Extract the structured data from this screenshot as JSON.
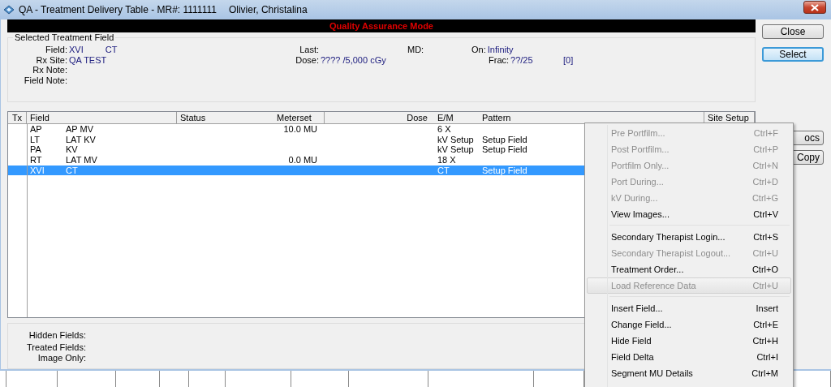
{
  "window": {
    "title": "QA - Treatment Delivery Table - MR#: 1111111",
    "patient": "Olivier, Christalina"
  },
  "banner": "Quality Assurance Mode",
  "selected_field": {
    "title": "Selected Treatment Field",
    "rows": [
      [
        {
          "label": "Field:",
          "values": [
            "XVI",
            "CT"
          ]
        },
        {
          "label": "Last:"
        },
        {
          "label": "MD:"
        },
        {
          "label": "On:",
          "values": [
            "Infinity"
          ]
        }
      ],
      [
        {
          "label": "Rx Site:",
          "values": [
            "QA TEST"
          ]
        },
        {
          "label": "Dose:",
          "values": [
            "???? /5,000 cGy"
          ]
        },
        "",
        {
          "label": "Frac:",
          "values": [
            "??/25"
          ]
        },
        {
          "values": [
            "[0]"
          ]
        }
      ],
      [
        {
          "label": "Rx Note:"
        }
      ],
      [
        {
          "label": "Field Note:"
        }
      ]
    ]
  },
  "table": {
    "columns": [
      "Tx",
      "Field",
      "Status",
      "Meterset",
      "Dose",
      "E/M",
      "Pattern",
      "Site Setup"
    ],
    "rows": [
      {
        "code": "AP",
        "name": "AP MV",
        "meterset": "10.0 MU",
        "em": "6 X",
        "selected": false
      },
      {
        "code": "LT",
        "name": "LAT KV",
        "em": "kV Setup",
        "pattern": "Setup Field",
        "selected": false
      },
      {
        "code": "PA",
        "name": "KV",
        "em": "kV Setup",
        "pattern": "Setup Field",
        "selected": false
      },
      {
        "code": "RT",
        "name": "LAT MV",
        "meterset": "0.0 MU",
        "em": "18 X",
        "selected": false
      },
      {
        "code": "XVI",
        "name": "CT",
        "em": "CT",
        "pattern": "Setup Field",
        "selected": true
      }
    ]
  },
  "summary": [
    "Hidden Fields:",
    "Treated Fields:",
    "Image Only:"
  ],
  "buttons": [
    {
      "label": "Close",
      "kind": "normal"
    },
    {
      "label": "Select",
      "kind": "focused"
    },
    {
      "label": "ocs",
      "kind": "covered"
    },
    {
      "label": "Copy",
      "kind": "covered"
    }
  ],
  "context_menu": [
    {
      "kind": "item",
      "label": "Pre Portfilm...",
      "shortcut": "Ctrl+F",
      "disabled": true,
      "highlighted": false
    },
    {
      "kind": "item",
      "label": "Post Portfilm...",
      "shortcut": "Ctrl+P",
      "disabled": true,
      "highlighted": false
    },
    {
      "kind": "item",
      "label": "Portfilm Only...",
      "shortcut": "Ctrl+N",
      "disabled": true,
      "highlighted": false
    },
    {
      "kind": "item",
      "label": "Port During...",
      "shortcut": "Ctrl+D",
      "disabled": true,
      "highlighted": false
    },
    {
      "kind": "item",
      "label": "kV During...",
      "shortcut": "Ctrl+G",
      "disabled": true,
      "highlighted": false
    },
    {
      "kind": "item",
      "label": "View Images...",
      "shortcut": "Ctrl+V",
      "disabled": false,
      "highlighted": false
    },
    {
      "kind": "separator"
    },
    {
      "kind": "item",
      "label": "Secondary Therapist Login...",
      "shortcut": "Ctrl+S",
      "disabled": false,
      "highlighted": false
    },
    {
      "kind": "item",
      "label": "Secondary Therapist Logout...",
      "shortcut": "Ctrl+U",
      "disabled": true,
      "highlighted": false
    },
    {
      "kind": "item",
      "label": "Treatment Order...",
      "shortcut": "Ctrl+O",
      "disabled": false,
      "highlighted": false
    },
    {
      "kind": "item",
      "label": "Load Reference Data",
      "shortcut": "Ctrl+U",
      "disabled": true,
      "highlighted": true
    },
    {
      "kind": "separator"
    },
    {
      "kind": "item",
      "label": "Insert Field...",
      "shortcut": "Insert",
      "disabled": false,
      "highlighted": false
    },
    {
      "kind": "item",
      "label": "Change Field...",
      "shortcut": "Ctrl+E",
      "disabled": false,
      "highlighted": false
    },
    {
      "kind": "item",
      "label": "Hide Field",
      "shortcut": "Ctrl+H",
      "disabled": false,
      "highlighted": false
    },
    {
      "kind": "item",
      "label": "Field Delta",
      "shortcut": "Ctrl+I",
      "disabled": false,
      "highlighted": false
    },
    {
      "kind": "item",
      "label": "Segment MU Details",
      "shortcut": "Ctrl+M",
      "disabled": false,
      "highlighted": false
    }
  ]
}
